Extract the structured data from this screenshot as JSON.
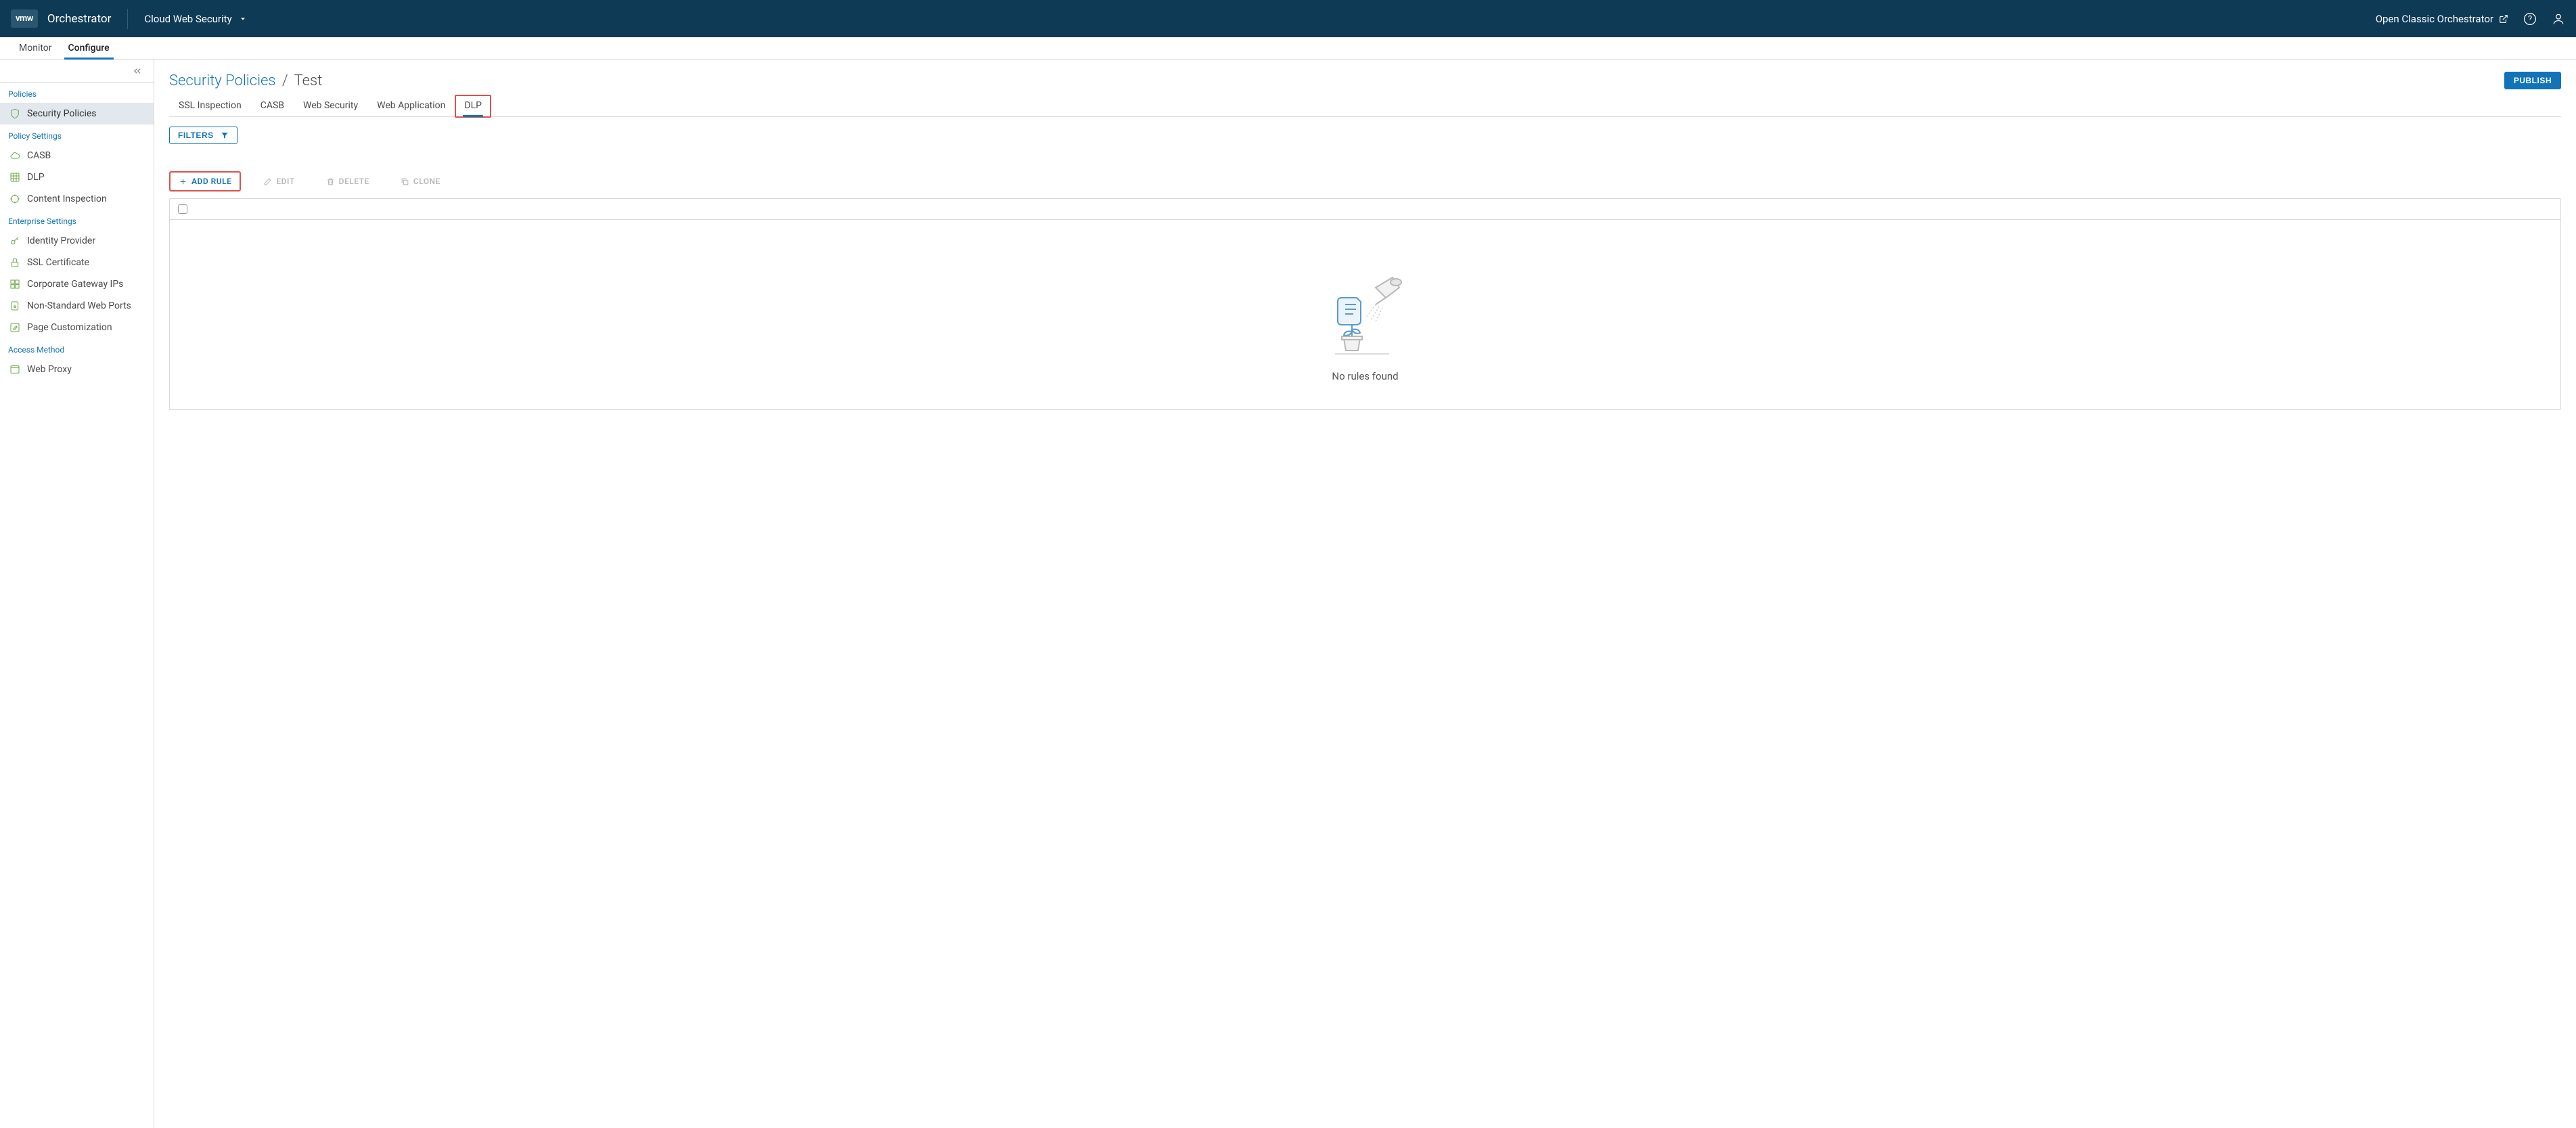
{
  "header": {
    "logo_text": "vmw",
    "app_title": "Orchestrator",
    "context_dropdown": "Cloud Web Security",
    "classic_link": "Open Classic Orchestrator"
  },
  "secondary_nav": {
    "tabs": [
      "Monitor",
      "Configure"
    ],
    "active_index": 1
  },
  "sidebar": {
    "sections": [
      {
        "label": "Policies",
        "items": [
          {
            "label": "Security Policies",
            "icon": "shield",
            "active": true
          }
        ]
      },
      {
        "label": "Policy Settings",
        "items": [
          {
            "label": "CASB",
            "icon": "cloud"
          },
          {
            "label": "DLP",
            "icon": "grid"
          },
          {
            "label": "Content Inspection",
            "icon": "crosshair"
          }
        ]
      },
      {
        "label": "Enterprise Settings",
        "items": [
          {
            "label": "Identity Provider",
            "icon": "key"
          },
          {
            "label": "SSL Certificate",
            "icon": "lock"
          },
          {
            "label": "Corporate Gateway IPs",
            "icon": "boxes"
          },
          {
            "label": "Non-Standard Web Ports",
            "icon": "clipboard-lock"
          },
          {
            "label": "Page Customization",
            "icon": "edit-square"
          }
        ]
      },
      {
        "label": "Access Method",
        "items": [
          {
            "label": "Web Proxy",
            "icon": "window"
          }
        ]
      }
    ]
  },
  "breadcrumb": {
    "parent": "Security Policies",
    "current": "Test"
  },
  "publish_label": "PUBLISH",
  "policy_tabs": {
    "tabs": [
      "SSL Inspection",
      "CASB",
      "Web Security",
      "Web Application",
      "DLP"
    ],
    "active_index": 4
  },
  "filters_label": "FILTERS",
  "actions": {
    "add": "ADD RULE",
    "edit": "EDIT",
    "delete": "DELETE",
    "clone": "CLONE"
  },
  "empty_state_text": "No rules found"
}
